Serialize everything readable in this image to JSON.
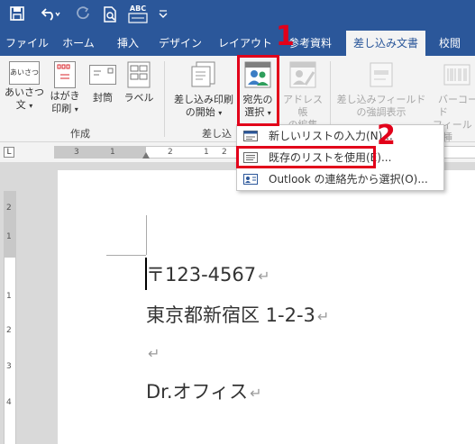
{
  "qat": {
    "save_icon": "save-icon",
    "undo_icon": "undo-icon",
    "redo_icon": "redo-icon",
    "print_preview_icon": "print-preview-icon",
    "spelling_icon": "spelling-icon",
    "spelling_text": "ABC",
    "customize_icon": "customize-qat-icon"
  },
  "tabs": [
    "ファイル",
    "ホーム",
    "挿入",
    "デザイン",
    "レイアウト",
    "参考資料",
    "差し込み文書",
    "校閲"
  ],
  "active_tab": "差し込み文書",
  "ribbon": {
    "create_group": {
      "label": "作成",
      "greeting": {
        "line1": "あいさつ",
        "line2": "文",
        "icon_text": "あいさつ"
      },
      "postcard": {
        "line1": "はがき",
        "line2": "印刷"
      },
      "envelope": {
        "label": "封筒"
      },
      "label_btn": {
        "label": "ラベル"
      }
    },
    "start_group": {
      "label": "差し込",
      "start_merge": {
        "line1": "差し込み印刷",
        "line2": "の開始"
      },
      "select_recipients": {
        "line1": "宛先の",
        "line2": "選択"
      },
      "edit_list": {
        "line1": "アドレス帳",
        "line2": "の編集"
      }
    },
    "highlight_fields": {
      "line1": "差し込みフィールド",
      "line2": "の強調表示"
    },
    "barcode": {
      "line1": "バーコード",
      "line2": "フィールドの挿"
    }
  },
  "menu": {
    "items": [
      {
        "label": "新しいリストの入力(N)...",
        "icon": "new-list-icon"
      },
      {
        "label": "既存のリストを使用(E)...",
        "icon": "existing-list-icon"
      },
      {
        "label": "Outlook の連絡先から選択(O)...",
        "icon": "outlook-contacts-icon"
      }
    ]
  },
  "callouts": {
    "step1": "1",
    "step2": "2"
  },
  "ruler": {
    "corner": "L",
    "h_ticks": [
      "3",
      "1",
      "2",
      "1",
      "2",
      "4",
      "6",
      "8",
      "10",
      "12"
    ],
    "v_ticks": [
      "2",
      "1",
      "1",
      "2",
      "3",
      "4"
    ]
  },
  "document": {
    "lines": [
      "〒123-4567",
      "東京都新宿区 1-2-3",
      "",
      "Dr.オフィス"
    ],
    "paragraph_mark": "↵"
  },
  "colors": {
    "brand": "#2b579a",
    "callout": "#e2001a",
    "ribbon_bg": "#f3f3f3"
  }
}
